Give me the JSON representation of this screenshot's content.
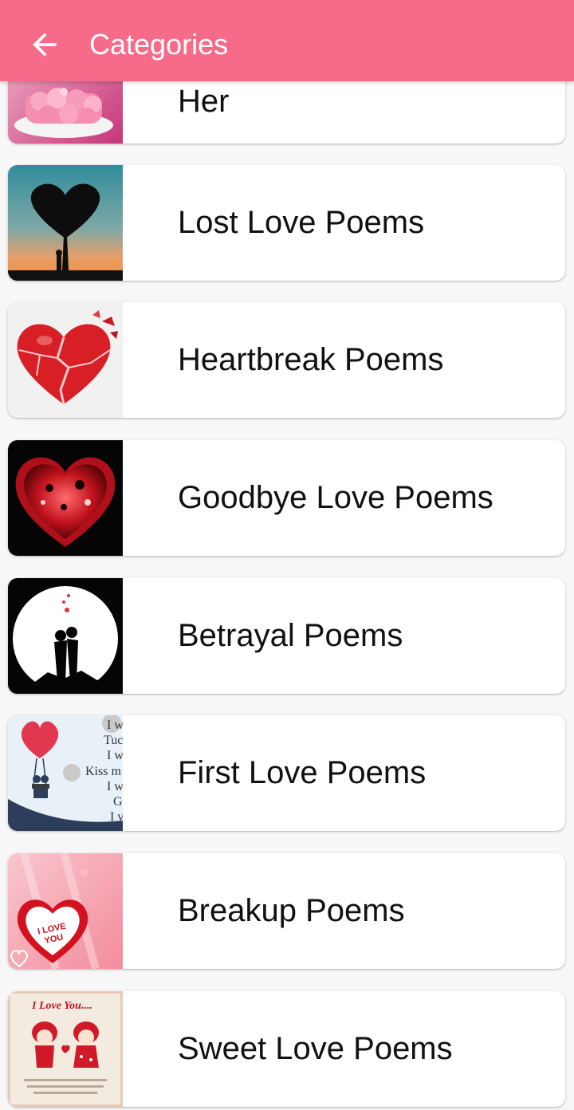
{
  "appbar": {
    "title": "Categories",
    "back_icon": "arrow-back-icon",
    "background": "#f76b8a"
  },
  "categories": [
    {
      "label": "Her",
      "thumb": "pink-cake"
    },
    {
      "label": "Lost Love Poems",
      "thumb": "heart-tree-sunset"
    },
    {
      "label": "Heartbreak Poems",
      "thumb": "shattered-heart"
    },
    {
      "label": "Goodbye Love Poems",
      "thumb": "glowing-heart-dark"
    },
    {
      "label": "Betrayal Poems",
      "thumb": "couple-moon-silhouette"
    },
    {
      "label": "First Love Poems",
      "thumb": "heart-balloon-swing"
    },
    {
      "label": "Breakup Poems",
      "thumb": "i-love-you-heart"
    },
    {
      "label": "Sweet Love Poems",
      "thumb": "cartoon-couple"
    }
  ],
  "thumb_text": {
    "first_love_lines": [
      "I w",
      "Tuc",
      "I w",
      "Kiss m",
      "I w",
      "G",
      "I v"
    ],
    "breakup_heart": [
      "I LOVE",
      "YOU"
    ],
    "sweet_title": "I Love You...."
  }
}
